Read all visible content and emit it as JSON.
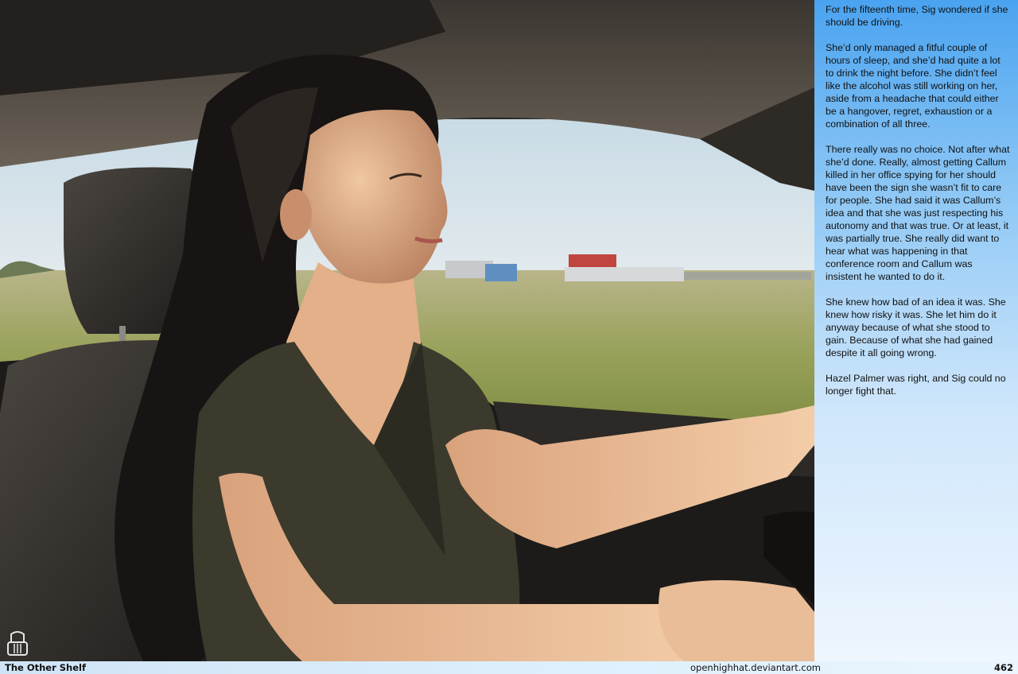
{
  "story": {
    "paragraphs": [
      "For the fifteenth time, Sig wondered if she should be driving.",
      "She’d only managed a fitful couple of hours of sleep, and she’d had quite a lot to drink the night before. She didn’t feel like the alcohol was still working on her, aside from a headache that could either be a hangover, regret, exhaustion or a combination of all three.",
      "There really was no choice. Not after what she’d done. Really, almost getting Callum killed in her office spying for her should have been the sign she wasn’t fit to care for people. She had said it was Callum’s idea and that she was just respecting his autonomy and that was true. Or at least, it was partially true. She really did want to hear what was happening in that conference room and Callum was insistent he wanted to do it.",
      "She knew how bad of an idea it was. She knew how risky it was. She let him do it anyway because of what she stood to gain. Because of what she had gained despite it all going wrong.",
      "Hazel Palmer was right, and Sig could no longer fight that."
    ]
  },
  "footer": {
    "title": "The Other Shelf",
    "site": "openhighhat.deviantart.com",
    "page_number": "462"
  },
  "colors": {
    "panel_top": "#4aa3f0",
    "panel_bottom": "#eef6fe",
    "text": "#111111"
  },
  "icons": {
    "logo": "open-high-hat-logo"
  }
}
